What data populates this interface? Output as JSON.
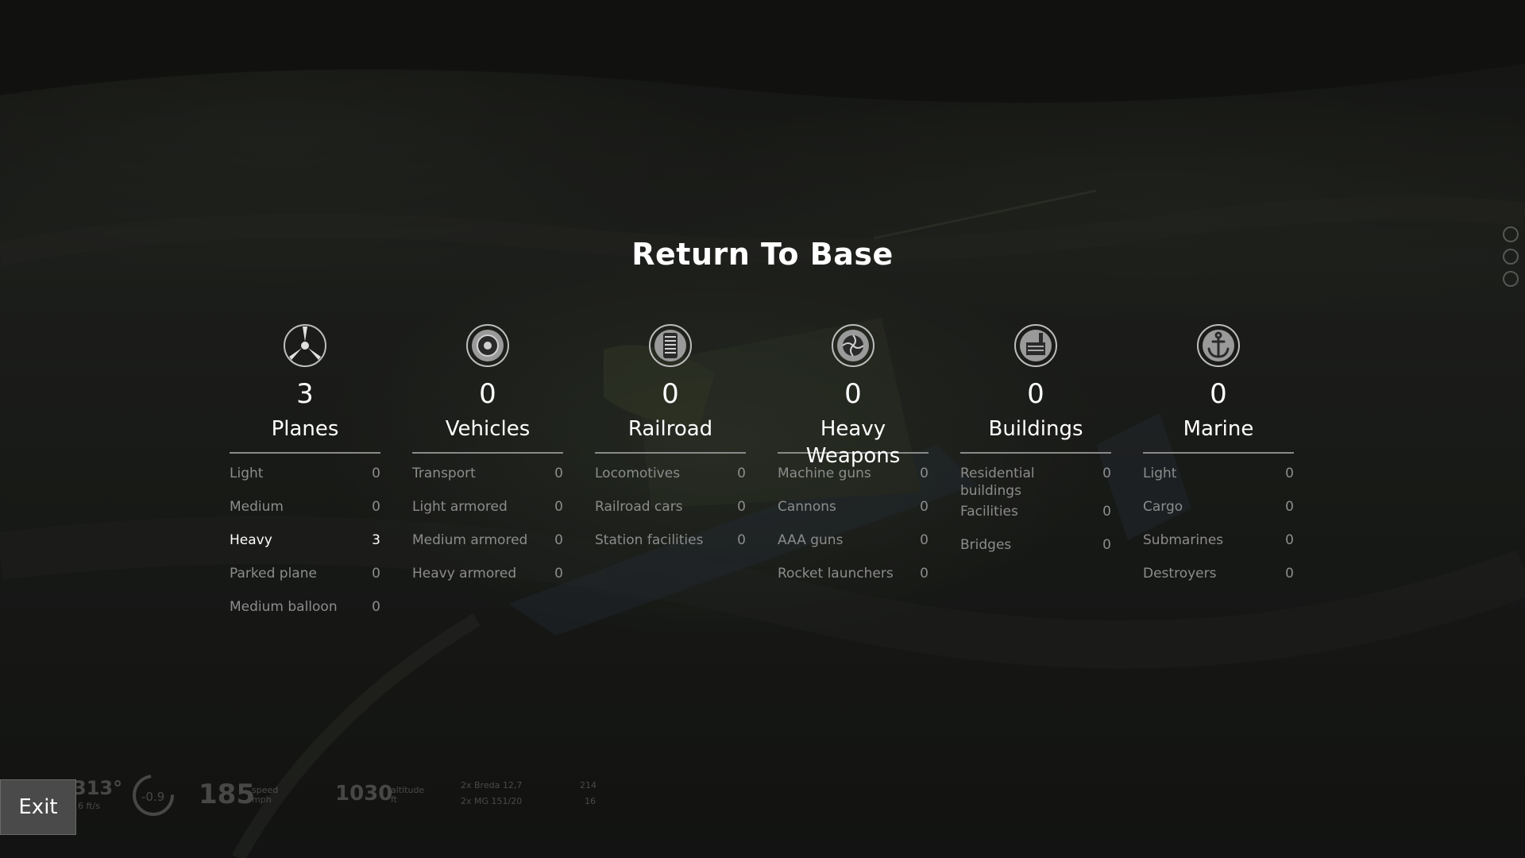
{
  "screen": {
    "title": "Return To Base",
    "exit_label": "Exit"
  },
  "categories": [
    {
      "icon": "propeller-icon",
      "count": "3",
      "name": "Planes",
      "rows": [
        {
          "label": "Light",
          "value": "0"
        },
        {
          "label": "Medium",
          "value": "0"
        },
        {
          "label": "Heavy",
          "value": "3",
          "highlighted": true
        },
        {
          "label": "Parked plane",
          "value": "0"
        },
        {
          "label": "Medium balloon",
          "value": "0"
        }
      ]
    },
    {
      "icon": "vehicle-wheel-icon",
      "count": "0",
      "name": "Vehicles",
      "rows": [
        {
          "label": "Transport",
          "value": "0"
        },
        {
          "label": "Light armored",
          "value": "0"
        },
        {
          "label": "Medium armored",
          "value": "0"
        },
        {
          "label": "Heavy armored",
          "value": "0"
        }
      ]
    },
    {
      "icon": "railroad-icon",
      "count": "0",
      "name": "Railroad",
      "rows": [
        {
          "label": "Locomotives",
          "value": "0"
        },
        {
          "label": "Railroad cars",
          "value": "0"
        },
        {
          "label": "Station facilities",
          "value": "0"
        }
      ]
    },
    {
      "icon": "gun-barrel-icon",
      "count": "0",
      "name": "Heavy Weapons",
      "rows": [
        {
          "label": "Machine guns",
          "value": "0"
        },
        {
          "label": "Cannons",
          "value": "0"
        },
        {
          "label": "AAA guns",
          "value": "0"
        },
        {
          "label": "Rocket launchers",
          "value": "0"
        }
      ]
    },
    {
      "icon": "factory-icon",
      "count": "0",
      "name": "Buildings",
      "rows": [
        {
          "label": "Residential buildings",
          "value": "0"
        },
        {
          "label": "Facilities",
          "value": "0"
        },
        {
          "label": "Bridges",
          "value": "0"
        }
      ]
    },
    {
      "icon": "anchor-icon",
      "count": "0",
      "name": "Marine",
      "rows": [
        {
          "label": "Light",
          "value": "0"
        },
        {
          "label": "Cargo",
          "value": "0"
        },
        {
          "label": "Submarines",
          "value": "0"
        },
        {
          "label": "Destroyers",
          "value": "0"
        }
      ]
    }
  ],
  "hud": {
    "heading": "313°",
    "vertical_speed": "6 ft/s",
    "gauge_value": "-0.9",
    "speed": "185",
    "speed_label": "speed",
    "speed_unit": "mph",
    "altitude": "1030",
    "altitude_label": "altitude",
    "altitude_unit": "ft",
    "weapons": [
      {
        "name": "2x Breda 12,7",
        "ammo": "214"
      },
      {
        "name": "2x MG 151/20",
        "ammo": "16"
      }
    ]
  }
}
